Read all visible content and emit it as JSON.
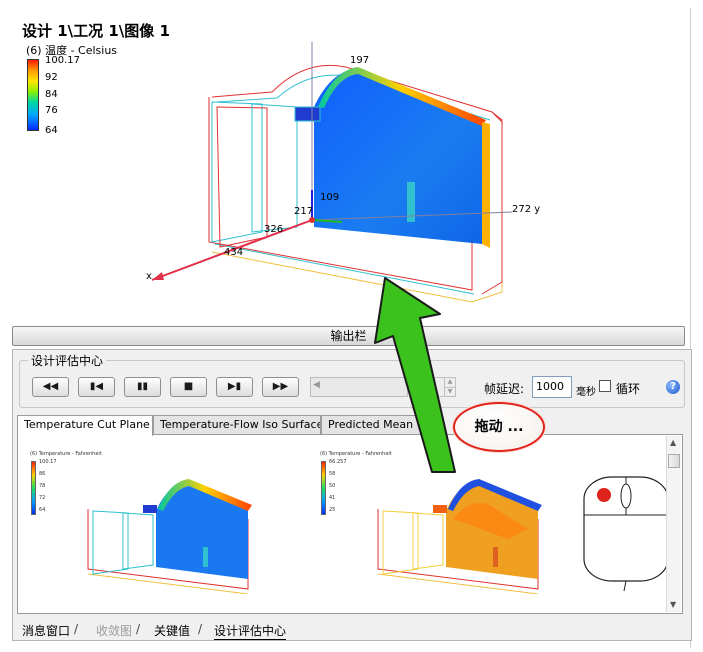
{
  "viewport": {
    "title": "设计 1\\工况 1\\图像 1",
    "legend": {
      "title": "(6) 温度 - Celsius",
      "ticks": [
        "100.17",
        "92",
        "84",
        "76",
        "64"
      ]
    },
    "axis_labels": {
      "top": "197",
      "z": "109",
      "origin": "217",
      "depth": "326",
      "x": "434",
      "y": "272 y",
      "x_letter": "x"
    }
  },
  "output_bar": {
    "label": "输出栏"
  },
  "design_review": {
    "group_title": "设计评估中心",
    "buttons": [
      {
        "name": "rewind-button",
        "glyph": "◀◀"
      },
      {
        "name": "step-back-button",
        "glyph": "▮◀"
      },
      {
        "name": "pause-button",
        "glyph": "▮▮"
      },
      {
        "name": "stop-button",
        "glyph": "■"
      },
      {
        "name": "step-forward-button",
        "glyph": "▶▮"
      },
      {
        "name": "fast-forward-button",
        "glyph": "▶▶"
      }
    ],
    "frame_delay_label": "帧延迟:",
    "frame_delay_value": "1000",
    "ms_label": "毫秒",
    "loop_label": "循环",
    "help_glyph": "?"
  },
  "tabs": [
    {
      "label": "Temperature Cut Plane",
      "active": true
    },
    {
      "label": "Temperature-Flow Iso Surface",
      "active": false
    },
    {
      "label": "Predicted Mean Vote",
      "active": false
    }
  ],
  "thumbnails": [
    {
      "legend_title": "(6) Temperature - Fahrenheit",
      "ticks": [
        "100.17",
        "86",
        "78",
        "72",
        "64"
      ],
      "colormap": "cool"
    },
    {
      "legend_title": "(6) Temperature - Fahrenheit",
      "ticks": [
        "66.257",
        "58",
        "50",
        "41",
        "25"
      ],
      "colormap": "warm"
    }
  ],
  "callout": {
    "text": "拖动 ..."
  },
  "bottom_tabs": [
    {
      "label": "消息窗口",
      "disabled": false
    },
    {
      "label": "收敛图",
      "disabled": true
    },
    {
      "label": "关键值",
      "disabled": false
    },
    {
      "label": "设计评估中心",
      "disabled": false
    }
  ],
  "colors": {
    "accent_green": "#3cc21c",
    "callout_red": "#e0231a",
    "mouse_button": "#e0231a",
    "temperature_hot": "#ff1a00",
    "temperature_cold": "#0028ff"
  }
}
